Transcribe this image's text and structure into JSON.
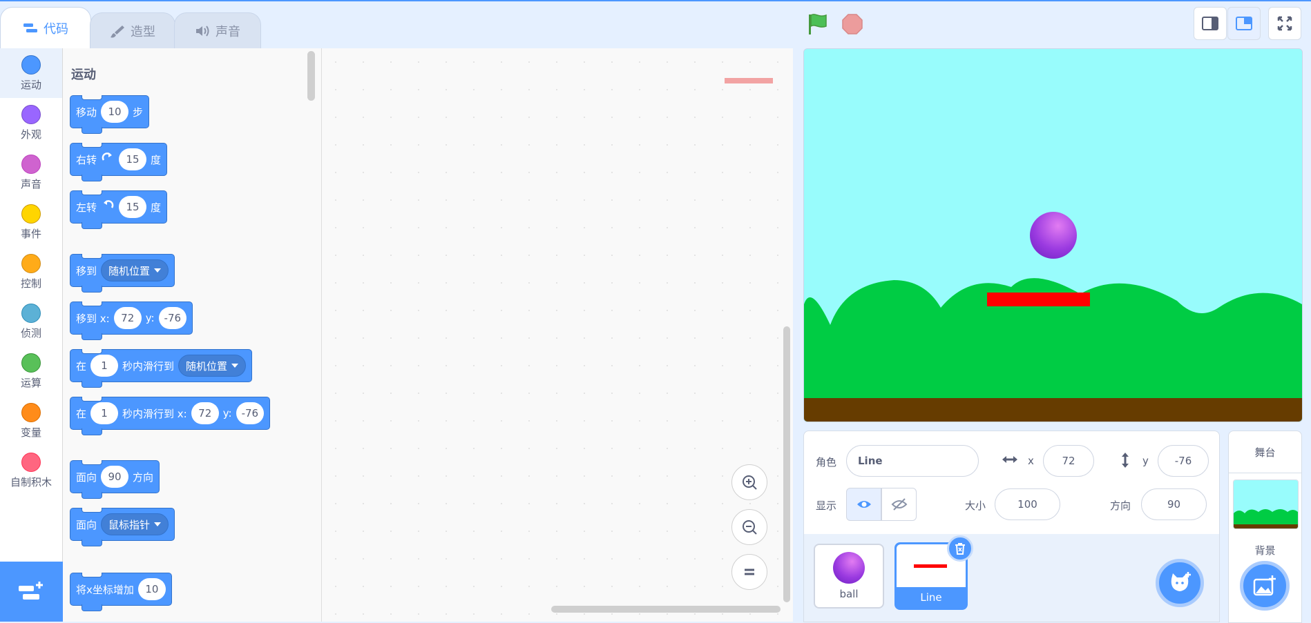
{
  "tabs": [
    {
      "label": "代码",
      "icon": "code-icon"
    },
    {
      "label": "造型",
      "icon": "brush-icon"
    },
    {
      "label": "声音",
      "icon": "speaker-icon"
    }
  ],
  "categories": [
    {
      "label": "运动",
      "color": "#4c97ff"
    },
    {
      "label": "外观",
      "color": "#9966ff"
    },
    {
      "label": "声音",
      "color": "#cf63cf"
    },
    {
      "label": "事件",
      "color": "#ffd500"
    },
    {
      "label": "控制",
      "color": "#ffab19"
    },
    {
      "label": "侦测",
      "color": "#5cb1d6"
    },
    {
      "label": "运算",
      "color": "#59c059"
    },
    {
      "label": "变量",
      "color": "#ff8c1a"
    },
    {
      "label": "自制积木",
      "color": "#ff6680"
    }
  ],
  "palette": {
    "title": "运动",
    "blocks": {
      "move": {
        "t1": "移动",
        "v1": "10",
        "t2": "步"
      },
      "turn_right": {
        "t1": "右转",
        "v1": "15",
        "t2": "度"
      },
      "turn_left": {
        "t1": "左转",
        "v1": "15",
        "t2": "度"
      },
      "goto": {
        "t1": "移到",
        "d1": "随机位置"
      },
      "goto_xy": {
        "t1": "移到 x:",
        "v1": "72",
        "t2": "y:",
        "v2": "-76"
      },
      "glide": {
        "t1": "在",
        "v1": "1",
        "t2": "秒内滑行到",
        "d1": "随机位置"
      },
      "glide_xy": {
        "t1": "在",
        "v1": "1",
        "t2": "秒内滑行到 x:",
        "v2": "72",
        "t3": "y:",
        "v3": "-76"
      },
      "point_dir": {
        "t1": "面向",
        "v1": "90",
        "t2": "方向"
      },
      "point_towards": {
        "t1": "面向",
        "d1": "鼠标指针"
      },
      "change_x": {
        "t1": "将x坐标增加",
        "v1": "10"
      }
    }
  },
  "colors": {
    "accent": "#4c97ff",
    "motion_block": "#4c97ff",
    "stage_sky": "#98fcfc",
    "hills": "#00cc44",
    "ground": "#663c00",
    "line_sprite": "#ff0000"
  },
  "sprite_info": {
    "sprite_label": "角色",
    "sprite_name": "Line",
    "x_label": "x",
    "x_value": "72",
    "y_label": "y",
    "y_value": "-76",
    "show_label": "显示",
    "size_label": "大小",
    "size_value": "100",
    "direction_label": "方向",
    "direction_value": "90"
  },
  "sprites": [
    {
      "name": "ball",
      "selected": false
    },
    {
      "name": "Line",
      "selected": true
    }
  ],
  "stage_panel": {
    "title": "舞台",
    "backdrop_label": "背景"
  }
}
